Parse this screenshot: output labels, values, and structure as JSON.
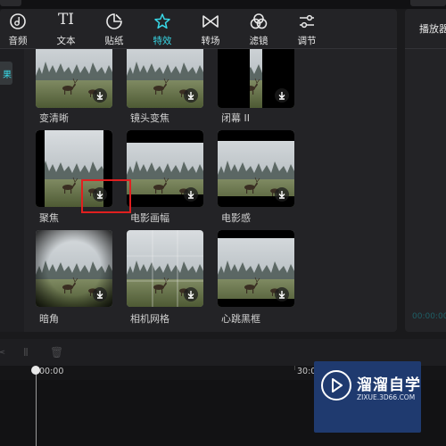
{
  "toolbar": {
    "items": [
      {
        "label": "音频",
        "icon": "audio-icon"
      },
      {
        "label": "文本",
        "icon_text": "TI"
      },
      {
        "label": "贴纸",
        "icon": "sticker-icon"
      },
      {
        "label": "特效",
        "icon": "effects-star-icon",
        "active": true
      },
      {
        "label": "转场",
        "icon": "transition-icon"
      },
      {
        "label": "滤镜",
        "icon": "filter-icon"
      },
      {
        "label": "调节",
        "icon": "adjust-icon"
      }
    ],
    "active_color": "#38d9e8"
  },
  "sidebar": {
    "active_tab": "果"
  },
  "effects": [
    {
      "name": "变清晰"
    },
    {
      "name": "镜头变焦"
    },
    {
      "name": "闭幕 II"
    },
    {
      "name": "聚焦"
    },
    {
      "name": "电影画幅"
    },
    {
      "name": "电影感"
    },
    {
      "name": "暗角"
    },
    {
      "name": "相机网格"
    },
    {
      "name": "心跳黑框"
    }
  ],
  "player": {
    "title": "播放器",
    "timecode": "00:00:00"
  },
  "timeline": {
    "ruler": [
      "00:00",
      "30:00"
    ]
  },
  "watermark": {
    "line1": "溜溜自学",
    "line2": "ZIXUE.3D66.COM"
  },
  "colors": {
    "highlight": "#e01f1f",
    "panel": "#232326"
  }
}
